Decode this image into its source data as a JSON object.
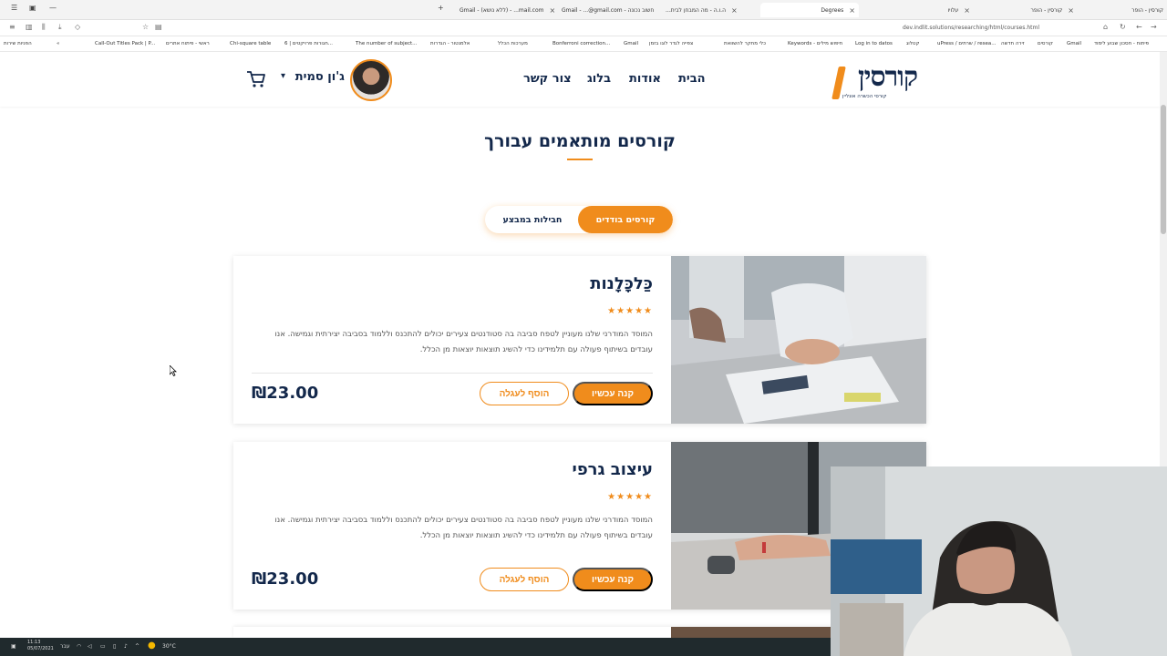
{
  "browser": {
    "tabs": [
      {
        "label": "Gmail - (ללא נושא) - ...mail.com",
        "active": false
      },
      {
        "label": "Gmail - ...@gmail.com - חשוב נכונה",
        "active": false
      },
      {
        "label": "...ה.ו.ה - מה המבחן לבית",
        "active": false
      },
      {
        "label": "Degrees",
        "active": true
      },
      {
        "label": "עלויו",
        "active": false
      },
      {
        "label": "קורסין - הופר",
        "active": false
      },
      {
        "label": "קורסין - הופר",
        "active": false
      }
    ],
    "url": "dev.indlit.solutions/researching/html/courses.html",
    "bookmarks": [
      "הפניות שירות",
      "Call-Out Titles Pack | P...",
      "ראשי - פיתוח אתרים",
      "Chi-square table",
      "חגורות פרויקטים | 6...",
      "The number of subject...",
      "אלמנטור - הגדרות",
      "מערכות הכלל",
      "Bonferroni correction...",
      "Gmail",
      "צפייה לגדר לוגו בזמן",
      "כלי מחקר להשוואת",
      "Keywords - חיפוש מילים",
      "Log in to datos",
      "קטלוג",
      "uPress / שרתים / resea...",
      "זירה חדשה",
      "Gmail",
      "קורסים",
      "Gmail",
      "פיתוח - חסכון שבוע לימוד"
    ]
  },
  "header": {
    "logo_text": "קורסין",
    "logo_tagline": "קורסי הכשרה אונליין",
    "nav": [
      "הבית",
      "אודות",
      "בלוג",
      "צור קשר"
    ],
    "user_name": "ג'ון סמית"
  },
  "page": {
    "title": "קורסים מותאמים עבורך",
    "segments": {
      "active": "קורסים בודדים",
      "inactive": "חבילות במבצע"
    }
  },
  "courses": [
    {
      "title": "כַּלכָּלָנות",
      "stars": "★★★★★",
      "description": "המוסד המודרני שלנו מעוניין לטפח סביבה בה סטודנטים צעירים יכולים להתכנס וללמוד בסביבה יצירתית וגמישה. אנו עובדים בשיתוף פעולה עם תלמידינו כדי להשיג תוצאות יוצאות מן הכלל.",
      "buy_label": "קנה עכשיו",
      "cart_label": "הוסף לעגלה",
      "price": "₪23.00"
    },
    {
      "title": "עיצוב גרפי",
      "stars": "★★★★★",
      "description": "המוסד המודרני שלנו מעוניין לטפח סביבה בה סטודנטים צעירים יכולים להתכנס וללמוד בסביבה יצירתית וגמישה. אנו עובדים בשיתוף פעולה עם תלמידינו כדי להשיג תוצאות יוצאות מן הכלל.",
      "buy_label": "קנה עכשיו",
      "cart_label": "הוסף לעגלה",
      "price": "₪23.00"
    }
  ],
  "taskbar": {
    "time": "11:13",
    "date": "05/07/2021",
    "weather": "30°C",
    "lang": "עבר"
  },
  "colors": {
    "accent": "#f08c1c",
    "navy": "#13284b"
  }
}
